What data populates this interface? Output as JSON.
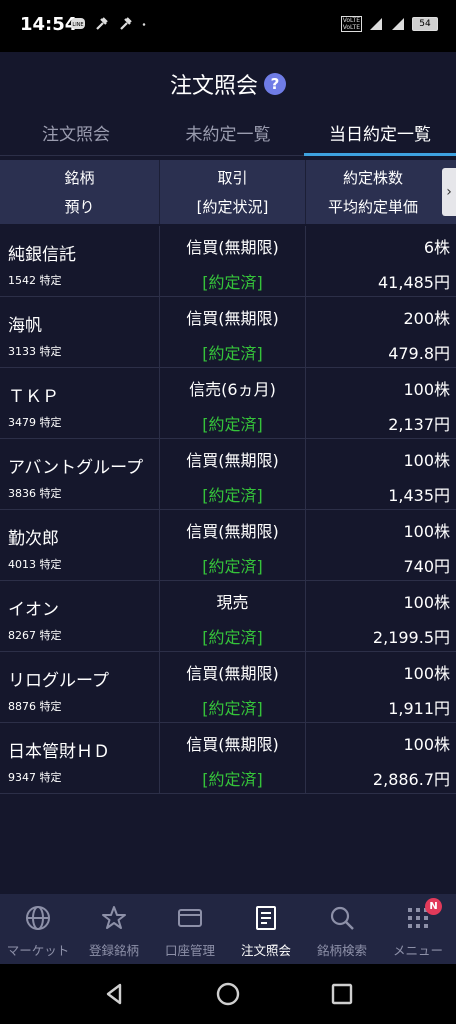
{
  "status_bar": {
    "time": "14:54",
    "battery": "54",
    "network": "4G"
  },
  "header": {
    "title": "注文照会",
    "help": "?"
  },
  "tabs": [
    {
      "label": "注文照会"
    },
    {
      "label": "未約定一覧"
    },
    {
      "label": "当日約定一覧"
    }
  ],
  "columns": {
    "c1_top": "銘柄",
    "c1_bottom": "預り",
    "c2_top": "取引",
    "c2_bottom": "[約定状況]",
    "c3_top": "約定株数",
    "c3_bottom": "平均約定単価",
    "more": "›"
  },
  "rows": [
    {
      "name": "純銀信託",
      "sub": "1542 特定",
      "trade": "信買(無期限)",
      "state": "[約定済]",
      "qty": "6株",
      "price": "41,485円"
    },
    {
      "name": "海帆",
      "sub": "3133 特定",
      "trade": "信買(無期限)",
      "state": "[約定済]",
      "qty": "200株",
      "price": "479.8円"
    },
    {
      "name": "ＴＫＰ",
      "sub": "3479 特定",
      "trade": "信売(6ヵ月)",
      "state": "[約定済]",
      "qty": "100株",
      "price": "2,137円"
    },
    {
      "name": "アバントグループ",
      "sub": "3836 特定",
      "trade": "信買(無期限)",
      "state": "[約定済]",
      "qty": "100株",
      "price": "1,435円"
    },
    {
      "name": "勤次郎",
      "sub": "4013 特定",
      "trade": "信買(無期限)",
      "state": "[約定済]",
      "qty": "100株",
      "price": "740円"
    },
    {
      "name": "イオン",
      "sub": "8267 特定",
      "trade": "現売",
      "state": "[約定済]",
      "qty": "100株",
      "price": "2,199.5円"
    },
    {
      "name": "リログループ",
      "sub": "8876 特定",
      "trade": "信買(無期限)",
      "state": "[約定済]",
      "qty": "100株",
      "price": "1,911円"
    },
    {
      "name": "日本管財ＨＤ",
      "sub": "9347 特定",
      "trade": "信買(無期限)",
      "state": "[約定済]",
      "qty": "100株",
      "price": "2,886.7円"
    }
  ],
  "bottom_nav": [
    {
      "label": "マーケット",
      "icon": "globe-icon"
    },
    {
      "label": "登録銘柄",
      "icon": "star-icon"
    },
    {
      "label": "口座管理",
      "icon": "card-icon"
    },
    {
      "label": "注文照会",
      "icon": "document-icon"
    },
    {
      "label": "銘柄検索",
      "icon": "search-icon"
    },
    {
      "label": "メニュー",
      "icon": "grid-icon",
      "badge": "N"
    }
  ],
  "colors": {
    "background": "#15172c",
    "accent": "#3ea2e0",
    "executed": "#35c33a",
    "badge": "#e23a5a"
  }
}
